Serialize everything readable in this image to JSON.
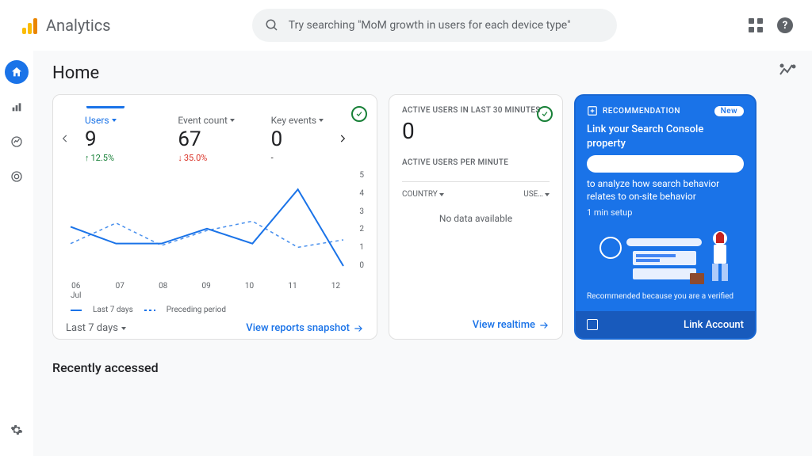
{
  "brand": "Analytics",
  "search_placeholder": "Try searching \"MoM growth in users for each device type\"",
  "page_title": "Home",
  "card1": {
    "metrics": [
      {
        "label": "Users",
        "value": "9",
        "change": "12.5%",
        "dir": "up"
      },
      {
        "label": "Event count",
        "value": "67",
        "change": "35.0%",
        "dir": "down"
      },
      {
        "label": "Key events",
        "value": "0",
        "change": "-",
        "dir": "none"
      }
    ],
    "legend_current": "Last 7 days",
    "legend_prev": "Preceding period",
    "date_selector": "Last 7 days",
    "footer_link": "View reports snapshot"
  },
  "card2": {
    "heading": "ACTIVE USERS IN LAST 30 MINUTES",
    "value": "0",
    "sub_heading": "ACTIVE USERS PER MINUTE",
    "col1": "COUNTRY",
    "col2": "USE…",
    "no_data": "No data available",
    "footer_link": "View realtime"
  },
  "card3": {
    "tag": "RECOMMENDATION",
    "badge": "New",
    "title": "Link your Search Console property",
    "subtitle": "to analyze how search behavior relates to on-site behavior",
    "setup_time": "1 min setup",
    "reason": "Recommended because you are a verified",
    "cta": "Link Account"
  },
  "recently_heading": "Recently accessed",
  "chart_data": {
    "type": "line",
    "title": "",
    "xlabel": "",
    "ylabel": "",
    "ylim": [
      0,
      5
    ],
    "categories": [
      "06",
      "07",
      "08",
      "09",
      "10",
      "11",
      "12"
    ],
    "x_sublabel": "Jul",
    "y_ticks": [
      0,
      1,
      2,
      3,
      4,
      5
    ],
    "series": [
      {
        "name": "Last 7 days",
        "style": "solid",
        "values": [
          2.1,
          1.2,
          1.2,
          2.0,
          1.2,
          4.1,
          0
        ]
      },
      {
        "name": "Preceding period",
        "style": "dashed",
        "values": [
          1.2,
          2.3,
          1.1,
          1.9,
          2.4,
          1.0,
          1.4
        ]
      }
    ]
  }
}
